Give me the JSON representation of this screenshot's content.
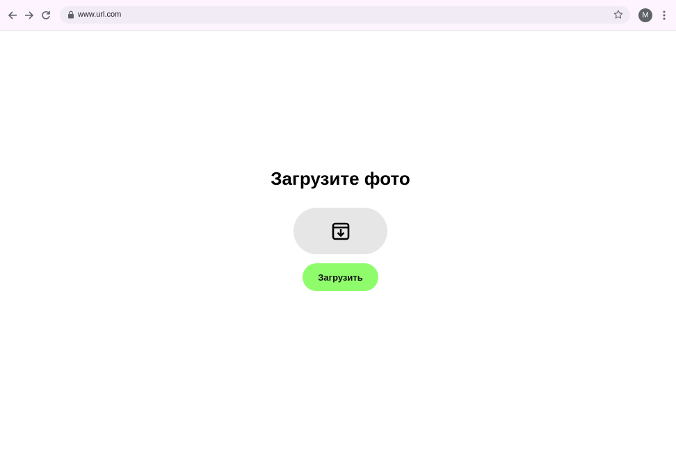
{
  "browser": {
    "url": "www.url.com",
    "avatar_letter": "M",
    "icons": {
      "back": "arrow-left-icon",
      "forward": "arrow-right-icon",
      "reload": "reload-icon",
      "lock": "lock-icon",
      "bookmark": "star-icon",
      "menu": "kebab-menu-icon"
    }
  },
  "main": {
    "title": "Загрузите фото",
    "drop_zone_icon": "archive-download-icon",
    "upload_label": "Загрузить"
  },
  "colors": {
    "upload_button": "#8ffc6c",
    "drop_zone": "#e6e6e6",
    "browser_bar": "#fdf4ff",
    "avatar": "#5f6368"
  }
}
